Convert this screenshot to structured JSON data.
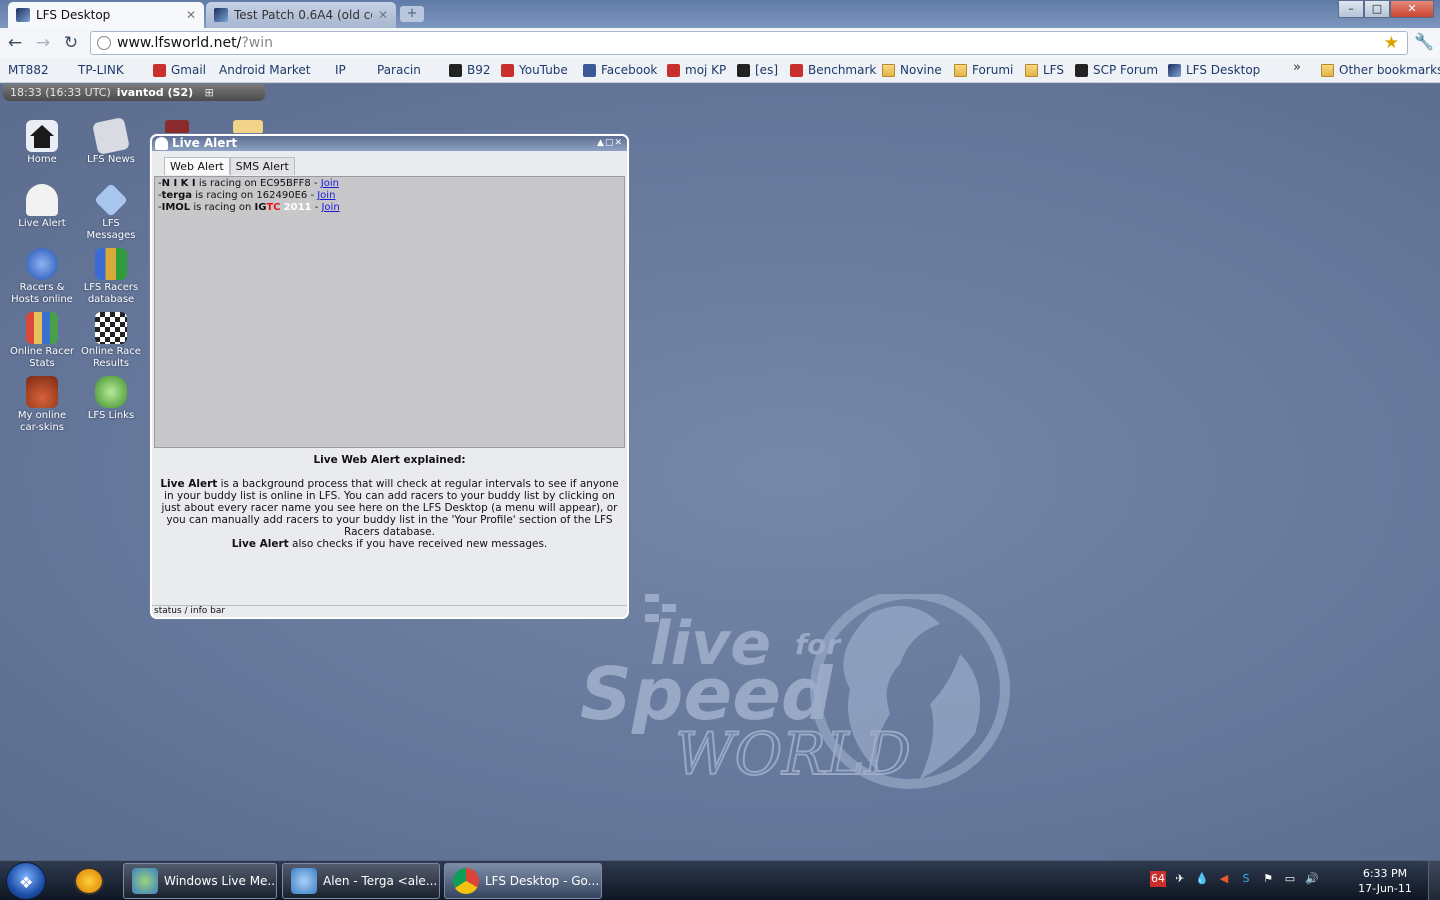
{
  "browser": {
    "tabs": [
      {
        "title": "LFS Desktop",
        "active": true
      },
      {
        "title": "Test Patch 0.6A4 (old con...",
        "active": false
      }
    ],
    "new_tab": "+",
    "window_controls": {
      "minimize": "–",
      "maximize": "□",
      "close": "✕"
    },
    "url_host": "www.lfsworld.net/",
    "url_path": "?win",
    "bookmarks": [
      {
        "label": "MT882",
        "icon": "page"
      },
      {
        "label": "TP-LINK",
        "icon": "page"
      },
      {
        "label": "Gmail",
        "icon": "red"
      },
      {
        "label": "Android Market",
        "icon": "page"
      },
      {
        "label": "IP",
        "icon": "page"
      },
      {
        "label": "Paracin",
        "icon": "page"
      },
      {
        "label": "B92",
        "icon": "dark"
      },
      {
        "label": "YouTube",
        "icon": "red"
      },
      {
        "label": "Facebook",
        "icon": "blue"
      },
      {
        "label": "moj KP",
        "icon": "red"
      },
      {
        "label": "[es]",
        "icon": "dark"
      },
      {
        "label": "Benchmark",
        "icon": "red"
      },
      {
        "label": "Novine",
        "icon": "folder"
      },
      {
        "label": "Forumi",
        "icon": "folder"
      },
      {
        "label": "LFS",
        "icon": "folder"
      },
      {
        "label": "SCP Forum",
        "icon": "dark"
      },
      {
        "label": "LFS Desktop",
        "icon": "lfs"
      }
    ],
    "other_bookmarks": "Other bookmarks",
    "overflow": "»"
  },
  "statusbar": {
    "time": "18:33 (16:33 UTC)",
    "user": "ivantod (S2)"
  },
  "desktop_icons": [
    {
      "label": "Home",
      "icon": "home-icon",
      "color": "#e9edf5"
    },
    {
      "label": "LFS News",
      "icon": "news-icon",
      "color": "#d8dbe2"
    },
    {
      "label": "Live Alert",
      "icon": "bell-icon",
      "color": "#f2f2f2"
    },
    {
      "label": "LFS Messages",
      "icon": "messages-icon",
      "color": "#a9c7ee"
    },
    {
      "label": "Racers & Hosts online",
      "icon": "globe-icon",
      "color": "#3b6fd0"
    },
    {
      "label": "LFS Racers database",
      "icon": "racers-icon",
      "color": "#d6a93a"
    },
    {
      "label": "Online Racer Stats",
      "icon": "stats-icon",
      "color": "#d9473d"
    },
    {
      "label": "Online Race Results",
      "icon": "flag-icon",
      "color": "#e7c25a"
    },
    {
      "label": "My online car-skins",
      "icon": "car-icon",
      "color": "#d7623a"
    },
    {
      "label": "LFS Links",
      "icon": "links-icon",
      "color": "#7ac257"
    }
  ],
  "live_alert": {
    "title": "Live Alert",
    "tabs": [
      "Web Alert",
      "SMS Alert"
    ],
    "entries": [
      {
        "racer": "N I K I",
        "mid": "is racing on",
        "server": "EC95BFF8",
        "join": "Join"
      },
      {
        "racer": "terga",
        "mid": "is racing on",
        "server": "162490E6",
        "join": "Join"
      },
      {
        "racer": "IMOL",
        "mid": "is racing on",
        "server_a": "IG",
        "server_b": "TC",
        "server_c": "2011",
        "join": "Join"
      }
    ],
    "explain_title": "Live Web Alert explained:",
    "explain_bold1": "Live Alert",
    "explain_text1": " is a background process that will check at regular intervals to see if anyone in your buddy list is online in LFS. You can add racers to your buddy list by clicking on just about every racer name you see here on the LFS Desktop (a menu will appear), or you can manually add racers to your buddy list in the 'Your Profile' section of the LFS Racers database.",
    "explain_bold2": "Live Alert",
    "explain_text2": " also checks if you have received new messages.",
    "status": "status / info bar"
  },
  "taskbar": {
    "tasks": [
      {
        "label": "Windows Live Me...",
        "active": false
      },
      {
        "label": "Alen - Terga <ale...",
        "active": false
      },
      {
        "label": "LFS Desktop - Go...",
        "active": true
      }
    ],
    "time": "6:33 PM",
    "date": "17-Jun-11"
  }
}
